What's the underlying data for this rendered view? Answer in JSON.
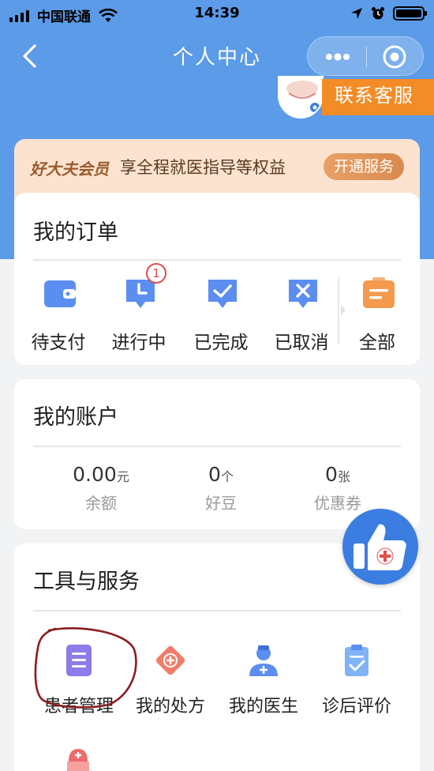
{
  "status_bar": {
    "carrier": "中国联通",
    "time": "14:39"
  },
  "nav": {
    "title": "个人中心"
  },
  "profile": {
    "service_label": "联系客服"
  },
  "member": {
    "brand": "好大夫会员",
    "text": "享全程就医指导等权益",
    "button": "开通服务"
  },
  "orders": {
    "title": "我的订单",
    "badge": "1",
    "items": [
      {
        "label": "待支付",
        "icon": "wallet-icon",
        "color": "#5b8ef0"
      },
      {
        "label": "进行中",
        "icon": "clock-chat-icon",
        "color": "#5b8ef0"
      },
      {
        "label": "已完成",
        "icon": "check-chat-icon",
        "color": "#5b8ef0"
      },
      {
        "label": "已取消",
        "icon": "x-chat-icon",
        "color": "#5b8ef0"
      },
      {
        "label": "全部",
        "icon": "orders-box-icon",
        "color": "#f39a4c"
      }
    ]
  },
  "account": {
    "title": "我的账户",
    "items": [
      {
        "value": "0.00",
        "unit": "元",
        "label": "余额"
      },
      {
        "value": "0",
        "unit": "个",
        "label": "好豆"
      },
      {
        "value": "0",
        "unit": "张",
        "label": "优惠券"
      }
    ]
  },
  "tools": {
    "title": "工具与服务",
    "items": [
      {
        "label": "患者管理",
        "icon": "patient-list-icon",
        "color": "#8c7be8"
      },
      {
        "label": "我的处方",
        "icon": "prescription-icon",
        "color": "#ef7d6a"
      },
      {
        "label": "我的医生",
        "icon": "doctor-icon",
        "color": "#5b8ef0"
      },
      {
        "label": "诊后评价",
        "icon": "clipboard-check-icon",
        "color": "#7fb3f5"
      }
    ]
  },
  "colors": {
    "hero": "#5b9be8",
    "accent_orange": "#f38b26",
    "badge_red": "#e34d4d"
  }
}
